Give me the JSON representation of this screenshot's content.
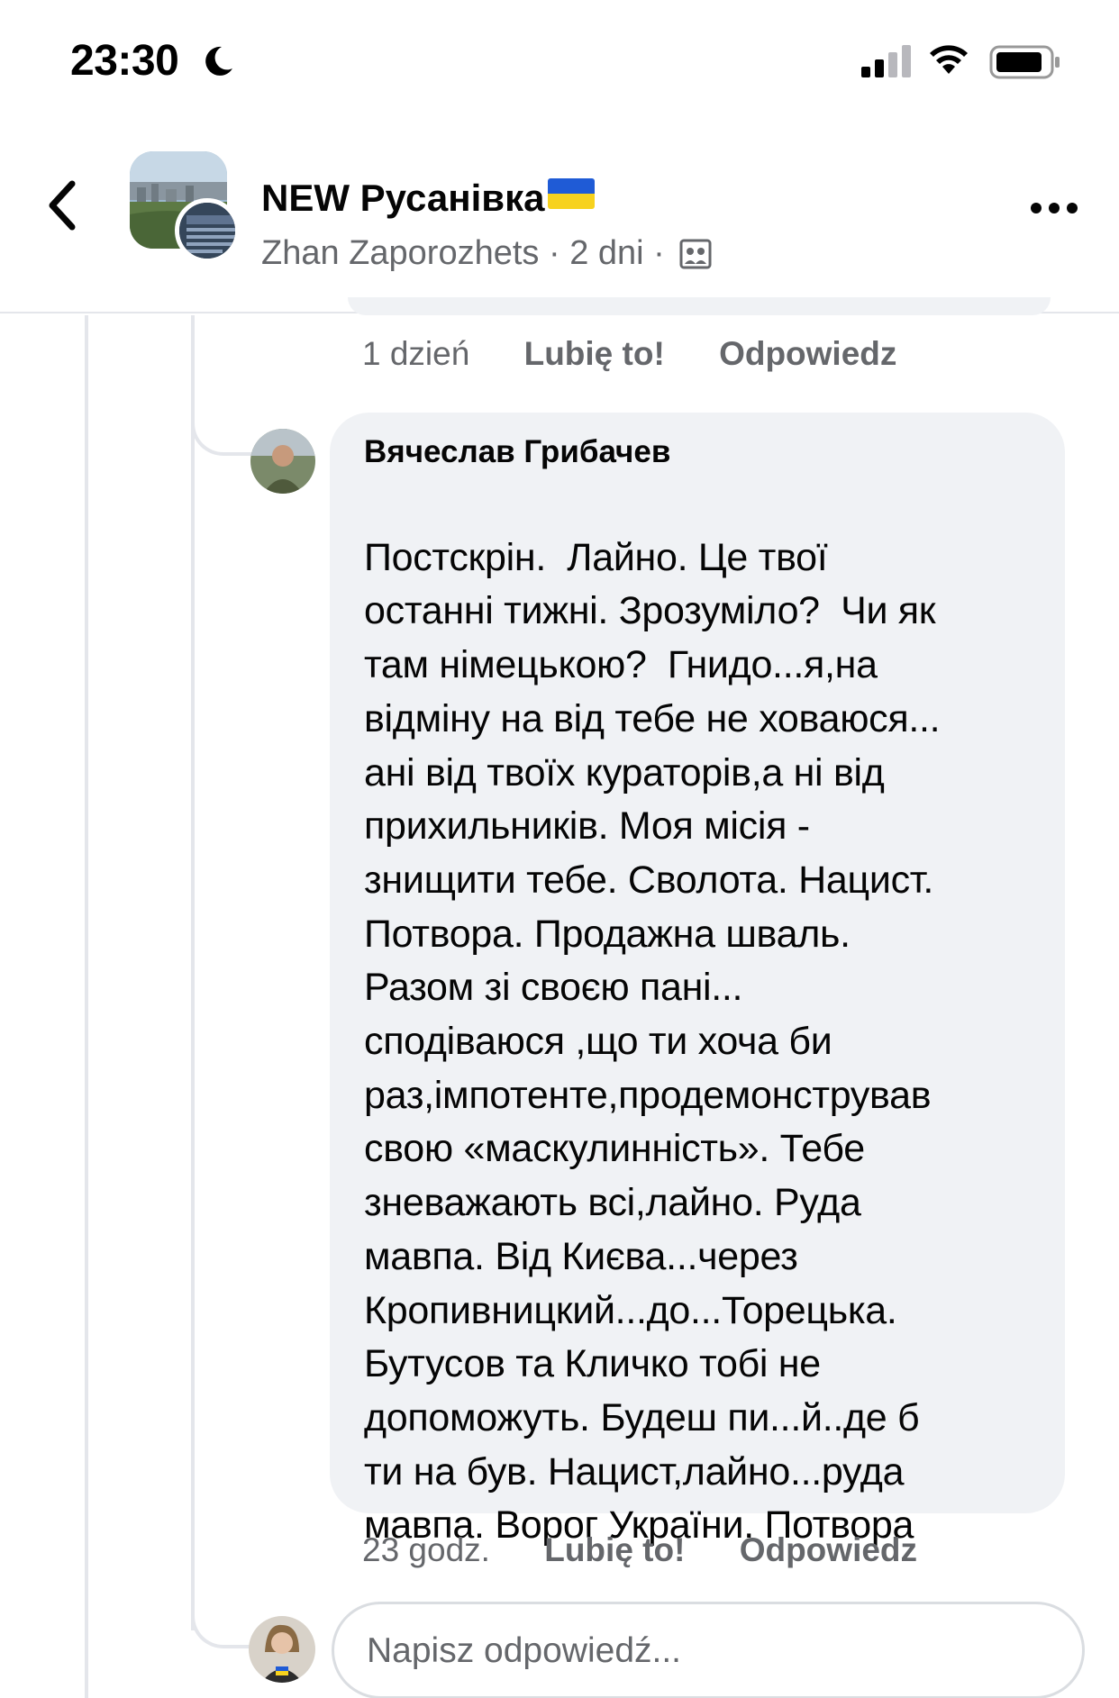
{
  "status_bar": {
    "time": "23:30",
    "icons": [
      "moon-icon",
      "cellular-signal-icon",
      "wifi-icon",
      "battery-icon"
    ]
  },
  "post_header": {
    "group_name": "NEW Русанівка",
    "flag_icon": "ukraine-flag-icon",
    "author": "Zhan Zaporozhets",
    "separator": "·",
    "age": "2 dni",
    "privacy_icon": "group-members-icon"
  },
  "previous_comment_actions": {
    "time": "1 dzień",
    "like_label": "Lubię to!",
    "reply_label": "Odpowiedz"
  },
  "comment": {
    "author": "Вячеслав Грибачев",
    "text_lines": [
      "Постскрін.  Лайно. Це твої",
      "останні тижні. Зрозуміло?  Чи як",
      "там німецькою?  Гнидо...я,на",
      "відміну на від тебе не ховаюся...",
      "ані від твоїх кураторів,а ні від",
      "прихильників. Моя місія -",
      "знищити тебе. Сволота. Нацист.",
      "Потвора. Продажна шваль.",
      "Разом зі своєю пані...",
      "сподіваюся ,що ти хоча би",
      "раз,імпотенте,продемонстрував",
      "свою «маскулинність». Тебе",
      "зневажають всі,лайно. Руда",
      "мавпа. Від Києва...через",
      "Кропивницкий...до...Торецька.",
      "Бутусов та Кличко тобі не",
      "допоможуть. Будеш пи...й..де б",
      "ти на був. Нацист,лайно...руда",
      "мавпа. Ворог України. Потвора"
    ]
  },
  "comment_actions": {
    "time": "23 godz.",
    "like_label": "Lubię to!",
    "reply_label": "Odpowiedz"
  },
  "reply_box": {
    "placeholder": "Napisz odpowiedź..."
  },
  "colors": {
    "bubble_bg": "#f0f2f5",
    "secondary_text": "#65676b",
    "primary_text": "#050505",
    "divider": "#e4e6eb"
  }
}
